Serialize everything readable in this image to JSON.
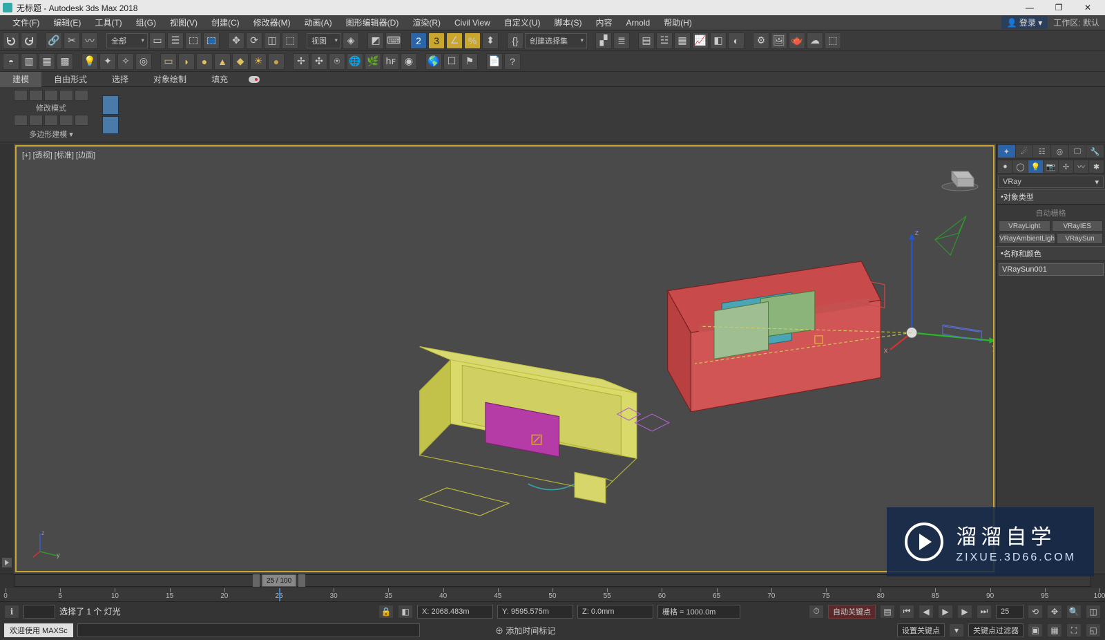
{
  "title": "无标题 - Autodesk 3ds Max 2018",
  "menus": [
    "文件(F)",
    "编辑(E)",
    "工具(T)",
    "组(G)",
    "视图(V)",
    "创建(C)",
    "修改器(M)",
    "动画(A)",
    "图形编辑器(D)",
    "渲染(R)",
    "Civil View",
    "自定义(U)",
    "脚本(S)",
    "内容",
    "Arnold",
    "帮助(H)"
  ],
  "login": "登录",
  "workspace_label": "工作区:",
  "workspace_value": "默认",
  "toolbar1": {
    "all_dropdown": "全部",
    "view_dropdown": "视图",
    "sel_set_dropdown": "创建选择集"
  },
  "ribbon_tabs": [
    "建模",
    "自由形式",
    "选择",
    "对象绘制",
    "填充"
  ],
  "ribbon": {
    "modify_mode": "修改模式",
    "poly_model": "多边形建模"
  },
  "viewport_label": "[+] [透视] [标准] [边面]",
  "command_panel": {
    "category": "VRay",
    "rollout_object_type": "对象类型",
    "auto_grid": "自动栅格",
    "types": [
      "VRayLight",
      "VRayIES",
      "VRayAmbientLigh",
      "VRaySun"
    ],
    "rollout_name_color": "名称和颜色",
    "object_name": "VRaySun001"
  },
  "timeline": {
    "handle": "25 / 100",
    "ticks": [
      0,
      5,
      10,
      15,
      20,
      25,
      30,
      35,
      40,
      45,
      50,
      55,
      60,
      65,
      70,
      75,
      80,
      85,
      90,
      95,
      100
    ],
    "cursor_at": 25
  },
  "status": {
    "selection": "选择了 1 个 灯光",
    "welcome": "欢迎使用 MAXSc",
    "coord_x": "X: 2068.483m",
    "coord_y": "Y: 9595.575m",
    "coord_z": "Z: 0.0mm",
    "grid": "栅格 = 1000.0m",
    "add_time_tag": "添加时间标记",
    "auto_key": "自动关键点",
    "set_key": "设置关键点",
    "key_filter": "关键点过滤器"
  },
  "watermark": {
    "cn": "溜溜自学",
    "en": "ZIXUE.3D66.COM"
  },
  "icons": {
    "login": "👤",
    "min": "—",
    "max": "❐",
    "close": "✕"
  }
}
